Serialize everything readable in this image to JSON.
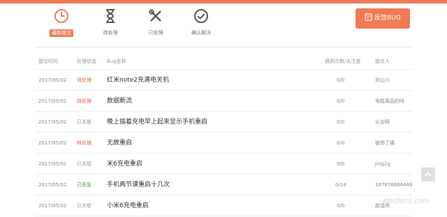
{
  "tabs": [
    {
      "label": "最新提交",
      "icon": "clock-icon",
      "active": true
    },
    {
      "label": "待处理",
      "icon": "hourglass-icon",
      "active": false
    },
    {
      "label": "已处理",
      "icon": "tools-icon",
      "active": false
    },
    {
      "label": "确认解决",
      "icon": "check-circle-icon",
      "active": false
    }
  ],
  "feedback_button": {
    "label": "反馈BUG",
    "icon": "bug-icon"
  },
  "table": {
    "headers": {
      "date": "提交时间",
      "status": "处理状态",
      "name": "Bug名称",
      "count": "遇到次数/关注度",
      "user": "提交人"
    },
    "rows": [
      {
        "date": "2017/05/02",
        "status": "待处理",
        "status_type": "pending",
        "name": "红米note2充满电关机",
        "count": "0/0",
        "user": "刘山川"
      },
      {
        "date": "2017/05/02",
        "status": "待处理",
        "status_type": "pending",
        "name": "数据断流",
        "count": "0/0",
        "user": "电能离品的呀"
      },
      {
        "date": "2017/05/02",
        "status": "已关联",
        "status_type": "closed",
        "name": "晚上插着充电早上起来显示手机重启",
        "count": "0/0",
        "user": "火去啊"
      },
      {
        "date": "2017/05/02",
        "status": "待处理",
        "status_type": "pending",
        "name": "无故重启",
        "count": "0/0",
        "user": "彼岸了痛"
      },
      {
        "date": "2017/05/02",
        "status": "已关联",
        "status_type": "closed",
        "name": "米6充电重启",
        "count": "0/0",
        "user": "Jing2g"
      },
      {
        "date": "2017/05/02",
        "status": "已答复",
        "status_type": "done",
        "name": "手机两节课重启十几次",
        "count": "0/24",
        "user": "187826886448"
      },
      {
        "date": "2017/05/02",
        "status": "已关联",
        "status_type": "closed",
        "name": "小米6充电重启",
        "count": "0/0",
        "user": "超话帅"
      }
    ]
  },
  "scroll_top": {
    "icon": "chevron-up-icon"
  },
  "watermark": {
    "text": "elecfans.com",
    "icon": "logo-icon"
  },
  "colors": {
    "accent": "#f07a55",
    "pending": "#e8603c",
    "done": "#5aa55a",
    "closed": "#999999"
  }
}
